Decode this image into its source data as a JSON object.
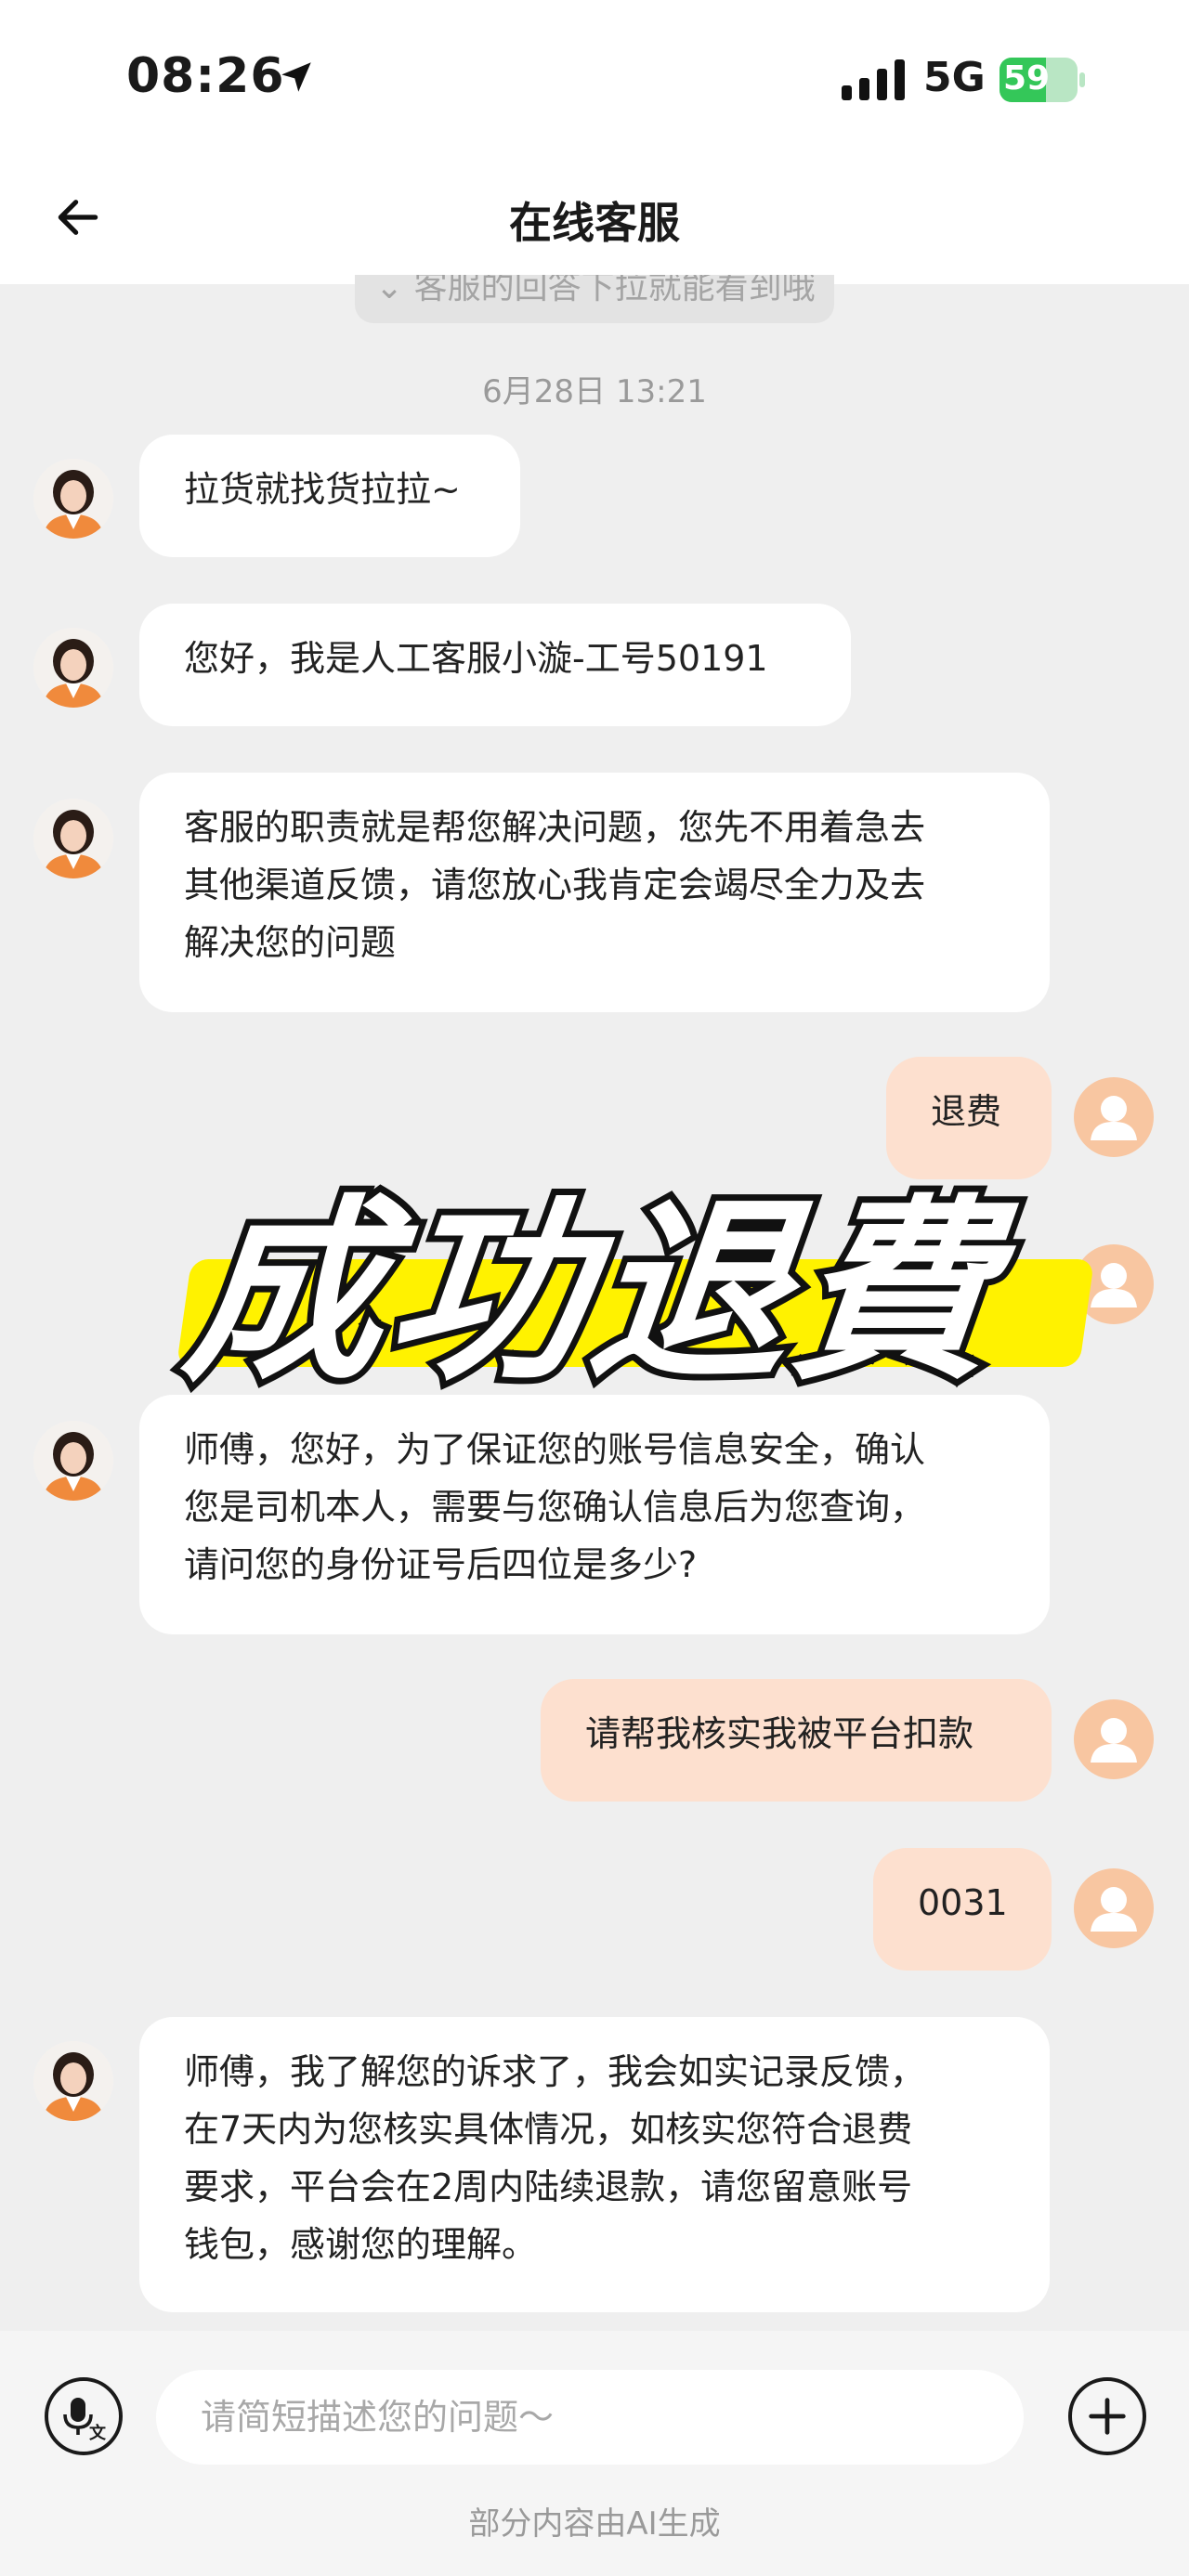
{
  "status_bar": {
    "time": "08:26",
    "network": "5G",
    "battery": "59",
    "battery_level": 0.59
  },
  "nav": {
    "title": "在线客服"
  },
  "chat": {
    "hint": "⌄ 客服的回答下拉就能看到哦",
    "timestamp": "6月28日 13:21",
    "messages": [
      {
        "from": "agent",
        "text": "拉货就找货拉拉~"
      },
      {
        "from": "agent",
        "text": "您好，我是人工客服小漩-工号50191"
      },
      {
        "from": "agent",
        "lines": [
          "客服的职责就是帮您解决问题，您先不用着急去",
          "其他渠道反馈，请您放心我肯定会竭尽全力及去",
          "解决您的问题"
        ]
      },
      {
        "from": "user",
        "text": "退费"
      },
      {
        "from": "agent",
        "lines": [
          "师傅，您好，为了保证您的账号信息安全，确认",
          "您是司机本人，需要与您确认信息后为您查询，",
          "请问您的身份证号后四位是多少?"
        ]
      },
      {
        "from": "user",
        "text": "请帮我核实我被平台扣款"
      },
      {
        "from": "user",
        "text": "0031"
      },
      {
        "from": "agent",
        "lines": [
          "师傅，我了解您的诉求了，我会如实记录反馈，",
          "在7天内为您核实具体情况，如核实您符合退费",
          "要求，平台会在2周内陆续退款，请您留意账号",
          "钱包，感谢您的理解。"
        ]
      }
    ]
  },
  "overlay": {
    "text": "成功退費"
  },
  "input": {
    "placeholder": "请简短描述您的问题～"
  },
  "footer": {
    "note": "部分内容由AI生成"
  },
  "icons": {
    "back": "arrow-left-icon",
    "location": "location-arrow-icon",
    "signal": "signal-bars-icon",
    "voice": "voice-to-text-icon",
    "add": "plus-circle-icon",
    "agent_avatar": "agent-avatar",
    "user_avatar": "user-avatar-icon"
  },
  "colors": {
    "accent": "#f8b48a",
    "user_bubble": "#fde0cf",
    "agent_bubble": "#ffffff",
    "background": "#efefef",
    "highlight": "#fff200",
    "battery": "#34c759"
  }
}
